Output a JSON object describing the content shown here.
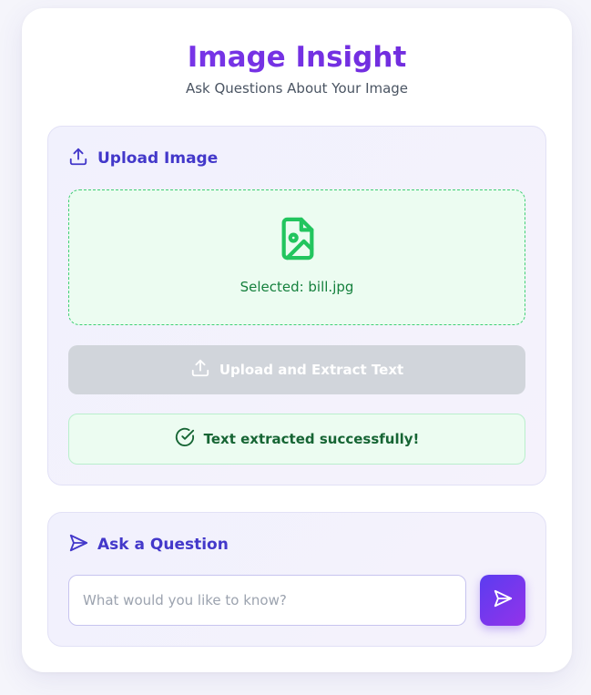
{
  "header": {
    "title": "Image Insight",
    "subtitle": "Ask Questions About Your Image"
  },
  "upload_section": {
    "heading": "Upload Image",
    "heading_icon": "upload-icon",
    "dropzone": {
      "icon": "image-file-icon",
      "selected_text": "Selected: bill.jpg"
    },
    "upload_button": {
      "label": "Upload and Extract Text",
      "icon": "upload-icon",
      "state": "disabled"
    },
    "status": {
      "text": "Text extracted successfully!",
      "icon": "check-circle-icon"
    }
  },
  "question_section": {
    "heading": "Ask a Question",
    "heading_icon": "send-icon",
    "input": {
      "placeholder": "What would you like to know?",
      "value": ""
    },
    "send_button_icon": "send-icon"
  },
  "colors": {
    "accent": "#7c3aed",
    "heading": "#4338ca",
    "success": "#22c55e",
    "success_bg": "#ecfcf1",
    "disabled": "#d1d5db"
  }
}
